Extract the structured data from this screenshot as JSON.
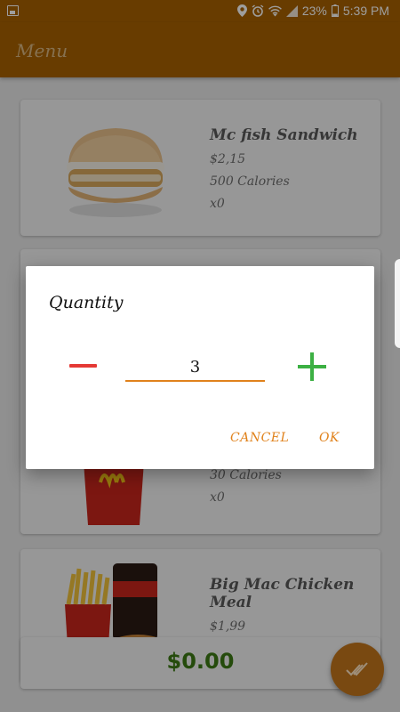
{
  "status_bar": {
    "battery_percent": "23%",
    "time": "5:39 PM",
    "icons": [
      "gallery-icon",
      "location-icon",
      "alarm-icon",
      "wifi-icon",
      "signal-icon",
      "battery-icon"
    ]
  },
  "app_bar": {
    "title": "Menu"
  },
  "menu_items": [
    {
      "name": "Mc fish Sandwich",
      "price": "$2,15",
      "calories": "500 Calories",
      "count": "x0"
    },
    {
      "name": "",
      "price": "",
      "calories": "30 Calories",
      "count": "x0"
    },
    {
      "name": "Big Mac Chicken Meal",
      "price": "$1,99",
      "calories": "",
      "count": ""
    }
  ],
  "total": {
    "amount": "$0.00"
  },
  "fab": {
    "icon": "done-all-icon"
  },
  "dialog": {
    "title": "Quantity",
    "quantity": "3",
    "cancel_label": "CANCEL",
    "ok_label": "OK",
    "minus_icon": "minus-icon",
    "plus_icon": "plus-icon"
  },
  "colors": {
    "app_bar": "#a86200",
    "accent": "#e0821c",
    "minus": "#e53935",
    "plus": "#3cb043",
    "total": "#3c7a14"
  }
}
